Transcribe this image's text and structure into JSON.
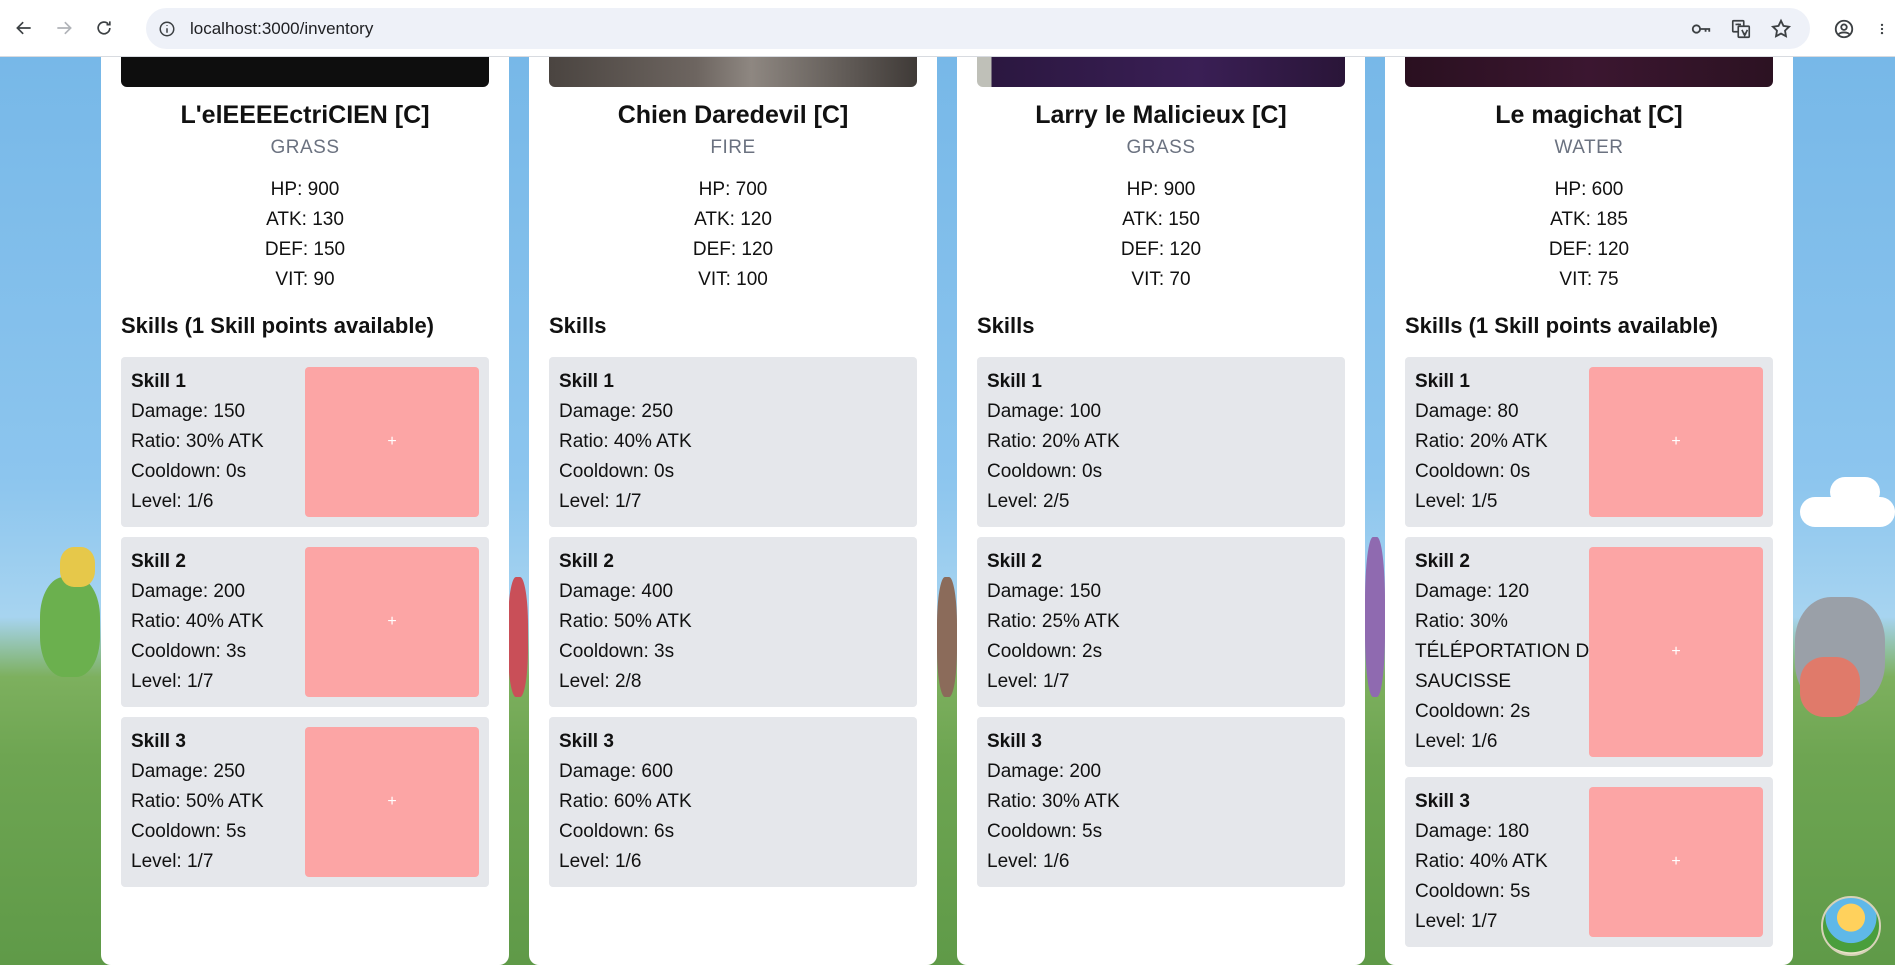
{
  "browser": {
    "url": "localhost:3000/inventory"
  },
  "cards": [
    {
      "name": "L'elEEEEctriCIEN [C]",
      "type": "GRASS",
      "stats": {
        "hp": "HP: 900",
        "atk": "ATK: 130",
        "def": "DEF: 150",
        "vit": "VIT: 90"
      },
      "skills_title": "Skills (1 Skill points available)",
      "skills": [
        {
          "name": "Skill 1",
          "lines": [
            "Damage: 150",
            "Ratio: 30% ATK",
            "Cooldown: 0s",
            "Level: 1/6"
          ],
          "button": "+"
        },
        {
          "name": "Skill 2",
          "lines": [
            "Damage: 200",
            "Ratio: 40% ATK",
            "Cooldown: 3s",
            "Level: 1/7"
          ],
          "button": "+"
        },
        {
          "name": "Skill 3",
          "lines": [
            "Damage: 250",
            "Ratio: 50% ATK",
            "Cooldown: 5s",
            "Level: 1/7"
          ],
          "button": "+"
        }
      ]
    },
    {
      "name": "Chien Daredevil [C]",
      "type": "FIRE",
      "stats": {
        "hp": "HP: 700",
        "atk": "ATK: 120",
        "def": "DEF: 120",
        "vit": "VIT: 100"
      },
      "skills_title": "Skills",
      "skills": [
        {
          "name": "Skill 1",
          "lines": [
            "Damage: 250",
            "Ratio: 40% ATK",
            "Cooldown: 0s",
            "Level: 1/7"
          ]
        },
        {
          "name": "Skill 2",
          "lines": [
            "Damage: 400",
            "Ratio: 50% ATK",
            "Cooldown: 3s",
            "Level: 2/8"
          ]
        },
        {
          "name": "Skill 3",
          "lines": [
            "Damage: 600",
            "Ratio: 60% ATK",
            "Cooldown: 6s",
            "Level: 1/6"
          ]
        }
      ]
    },
    {
      "name": "Larry le Malicieux [C]",
      "type": "GRASS",
      "stats": {
        "hp": "HP: 900",
        "atk": "ATK: 150",
        "def": "DEF: 120",
        "vit": "VIT: 70"
      },
      "skills_title": "Skills",
      "skills": [
        {
          "name": "Skill 1",
          "lines": [
            "Damage: 100",
            "Ratio: 20% ATK",
            "Cooldown: 0s",
            "Level: 2/5"
          ]
        },
        {
          "name": "Skill 2",
          "lines": [
            "Damage: 150",
            "Ratio: 25% ATK",
            "Cooldown: 2s",
            "Level: 1/7"
          ]
        },
        {
          "name": "Skill 3",
          "lines": [
            "Damage: 200",
            "Ratio: 30% ATK",
            "Cooldown: 5s",
            "Level: 1/6"
          ]
        }
      ]
    },
    {
      "name": "Le magichat [C]",
      "type": "WATER",
      "stats": {
        "hp": "HP: 600",
        "atk": "ATK: 185",
        "def": "DEF: 120",
        "vit": "VIT: 75"
      },
      "skills_title": "Skills (1 Skill points available)",
      "skills": [
        {
          "name": "Skill 1",
          "lines": [
            "Damage: 80",
            "Ratio: 20% ATK",
            "Cooldown: 0s",
            "Level: 1/5"
          ],
          "button": "+"
        },
        {
          "name": "Skill 2",
          "lines": [
            "Damage: 120",
            "Ratio: 30%",
            "TÉLÉPORTATION DE",
            "SAUCISSE",
            "Cooldown: 2s",
            "Level: 1/6"
          ],
          "button": "+"
        },
        {
          "name": "Skill 3",
          "lines": [
            "Damage: 180",
            "Ratio: 40% ATK",
            "Cooldown: 5s",
            "Level: 1/7"
          ],
          "button": "+"
        }
      ]
    }
  ],
  "colors": {
    "card_bg": "#ffffff",
    "skill_bg": "#e5e7eb",
    "upgrade_button": "#fca5a5",
    "type_text": "#6b7280"
  }
}
